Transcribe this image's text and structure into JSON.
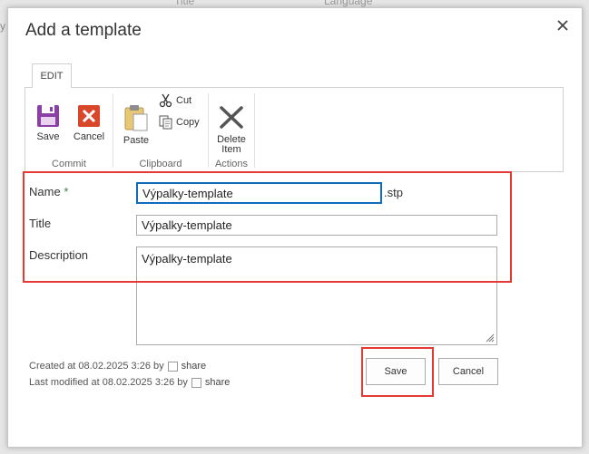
{
  "background": {
    "col_title": "Title",
    "col_language": "Language",
    "fragment": "y"
  },
  "dialog": {
    "title": "Add a template",
    "close_icon": "close-icon"
  },
  "ribbon": {
    "tab_label": "EDIT",
    "groups": {
      "commit": {
        "label": "Commit",
        "save_label": "Save",
        "cancel_label": "Cancel"
      },
      "clipboard": {
        "label": "Clipboard",
        "paste_label": "Paste",
        "cut_label": "Cut",
        "copy_label": "Copy"
      },
      "actions": {
        "label": "Actions",
        "delete_label_line1": "Delete",
        "delete_label_line2": "Item"
      }
    }
  },
  "form": {
    "name_label": "Name",
    "required_marker": "*",
    "name_value": "Výpalky-template",
    "name_suffix": ".stp",
    "title_label": "Title",
    "title_value": "Výpalky-template",
    "description_label": "Description",
    "description_value": "Výpalky-template"
  },
  "footer": {
    "created_text": "Created at 08.02.2025 3:26  by",
    "created_user": "share",
    "modified_text": "Last modified at 08.02.2025 3:26  by",
    "modified_user": "share",
    "save_button": "Save",
    "cancel_button": "Cancel"
  },
  "colors": {
    "accent_focus": "#0f6cbd",
    "highlight_red": "#e53935",
    "save_icon_purple": "#8b3fa7",
    "cancel_icon_red": "#d9472b",
    "paste_icon_tan": "#e8c776"
  }
}
